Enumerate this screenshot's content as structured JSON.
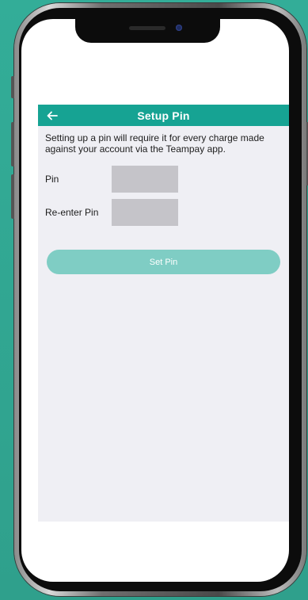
{
  "header": {
    "title": "Setup Pin",
    "back_icon": "arrow-left-icon"
  },
  "description": "Setting up a pin will require it for every charge made against your account via the Teampay app.",
  "form": {
    "pin_label": "Pin",
    "pin_value": "",
    "reenter_label": "Re-enter Pin",
    "reenter_value": ""
  },
  "actions": {
    "set_pin_label": "Set Pin"
  },
  "colors": {
    "background": "#32a894",
    "navbar": "#16a393",
    "button_disabled": "#7fcdc4",
    "content_bg": "#efeff4",
    "input_bg": "#c5c4c9"
  }
}
